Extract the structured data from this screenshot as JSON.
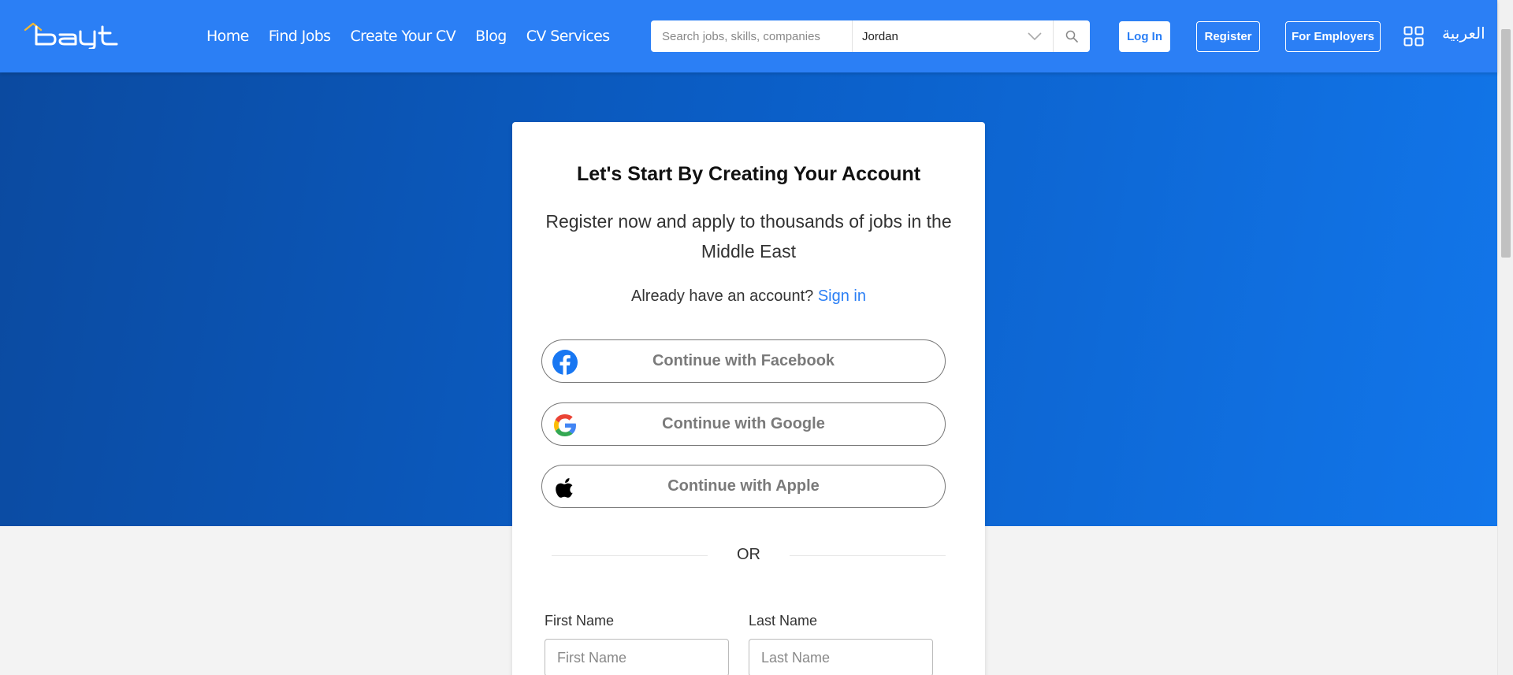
{
  "header": {
    "logo_text": "bayt",
    "nav": [
      "Home",
      "Find Jobs",
      "Create Your CV",
      "Blog",
      "CV Services"
    ],
    "search_placeholder": "Search jobs, skills, companies",
    "country": "Jordan",
    "login_label": "Log In",
    "register_label": "Register",
    "employers_label": "For Employers",
    "language_label": "العربية"
  },
  "card": {
    "title": "Let's Start By Creating Your Account",
    "subtitle": "Register now and apply to thousands of jobs in the Middle East",
    "already_text": "Already have an account?",
    "signin_label": "Sign in",
    "facebook_label": "Continue with Facebook",
    "google_label": "Continue with Google",
    "apple_label": "Continue with Apple",
    "or_label": "OR",
    "first_name_label": "First Name",
    "first_name_placeholder": "First Name",
    "last_name_label": "Last Name",
    "last_name_placeholder": "Last Name"
  },
  "colors": {
    "header_blue": "#2b7ff5",
    "hero_dark": "#0b4aa0",
    "hero_light": "#1276ea",
    "link_blue": "#2b7ff5",
    "logo_accent": "#f5b82e"
  },
  "icons": [
    "bayt-logo",
    "chevron-down-icon",
    "search-icon",
    "apps-grid-icon",
    "facebook-icon",
    "google-icon",
    "apple-icon"
  ]
}
